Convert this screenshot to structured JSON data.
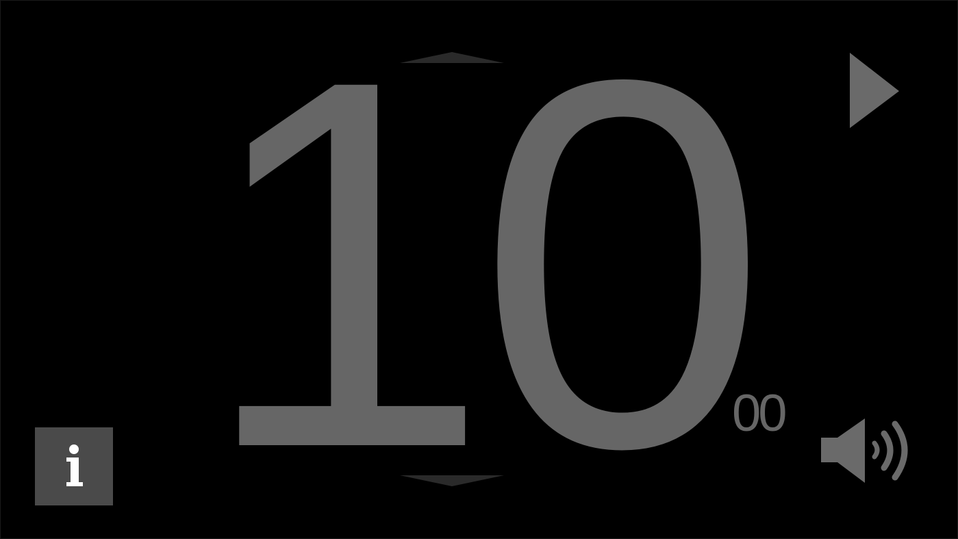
{
  "timer": {
    "minutes": "10",
    "seconds": "00"
  },
  "controls": {
    "increase_icon": "chevron-up-icon",
    "decrease_icon": "chevron-down-icon",
    "play_icon": "play-icon",
    "sound_icon": "speaker-sound-on-icon",
    "info_icon": "info-icon"
  },
  "colors": {
    "background": "#000000",
    "digits": "#666666",
    "arrows": "#2a2a2a",
    "icons": "#6a6a6a",
    "info_bg": "#4a4a4a",
    "info_glyph": "#ffffff"
  }
}
